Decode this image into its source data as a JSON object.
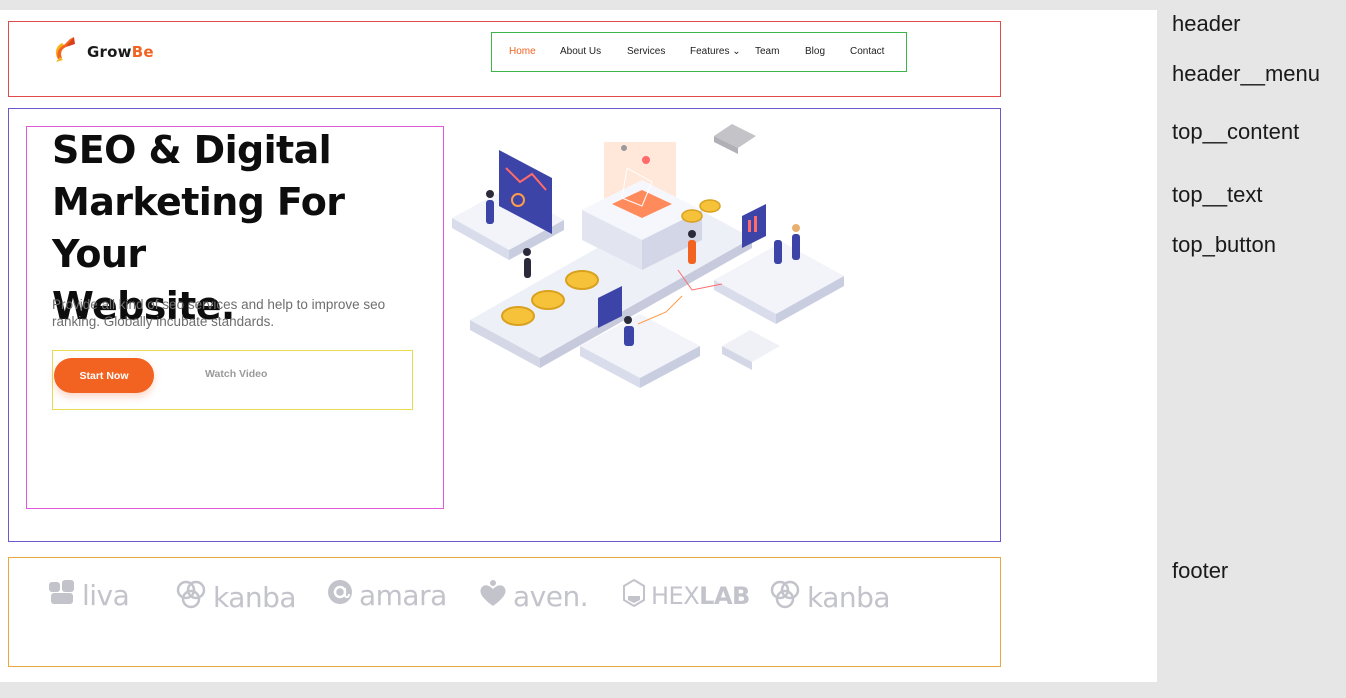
{
  "logo": {
    "text_main": "Grow",
    "text_accent": "Be"
  },
  "nav": {
    "items": [
      {
        "label": "Home",
        "active": true
      },
      {
        "label": "About Us",
        "active": false
      },
      {
        "label": "Services",
        "active": false
      },
      {
        "label": "Features ⌄",
        "active": false
      },
      {
        "label": "Team",
        "active": false
      },
      {
        "label": "Blog",
        "active": false
      },
      {
        "label": "Contact",
        "active": false
      }
    ]
  },
  "hero": {
    "title_line1": "SEO & Digital",
    "title_line2": "Marketing For Your",
    "title_line3": "Website.",
    "description": "Provide all kind of seo services and help to improve seo ranking. Globally incubate standards.",
    "primary_button": "Start Now",
    "secondary_button": "Watch Video"
  },
  "partners": [
    {
      "name": "liva",
      "icon": "liva-leaf-icon"
    },
    {
      "name": "kanba",
      "icon": "kanba-knot-icon"
    },
    {
      "name": "amara",
      "icon": "amara-at-icon"
    },
    {
      "name": "aven.",
      "icon": "aven-heart-icon"
    },
    {
      "name_light": "HEX",
      "name_bold": "LAB",
      "icon": "hexlab-flask-icon"
    },
    {
      "name": "kanba",
      "icon": "kanba-knot-icon"
    }
  ],
  "side_labels": {
    "header": "header",
    "header_menu": "header__menu",
    "top_content": "top__content",
    "top_text": "top__text",
    "top_button": "top_button",
    "footer": "footer"
  },
  "colors": {
    "accent": "#f26322",
    "text_dark": "#0d0d0d",
    "brand_gray": "#c3c3cb"
  }
}
